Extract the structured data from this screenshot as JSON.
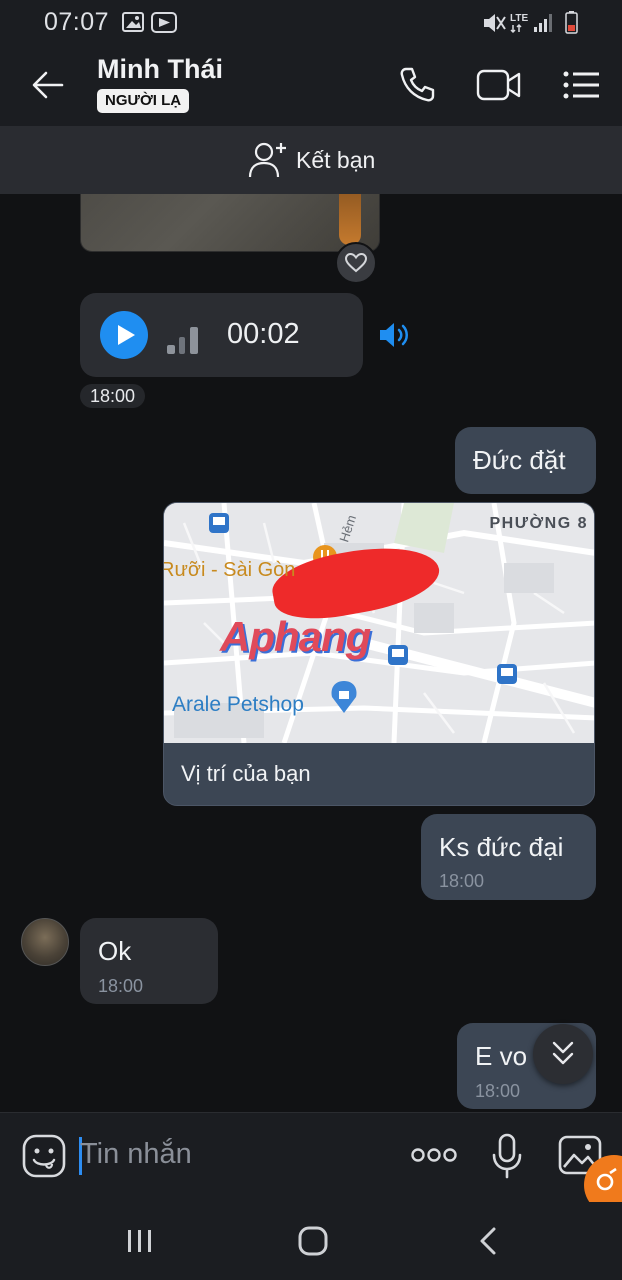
{
  "status_bar": {
    "time": "07:07",
    "network": "LTE"
  },
  "header": {
    "contact_name": "Minh Thái",
    "badge": "NGƯỜI LẠ",
    "icons": [
      "back-arrow-icon",
      "phone-icon",
      "video-call-icon",
      "menu-list-icon"
    ]
  },
  "add_friend": {
    "label": "Kết bạn",
    "icon": "add-user-icon"
  },
  "messages": {
    "voice": {
      "duration": "00:02",
      "time": "18:00"
    },
    "out1": {
      "text": "Đức đặt"
    },
    "location": {
      "caption": "Vị trí của bạn",
      "map_ward": "PHƯỜNG 8",
      "map_place": "Rưỡi - Sài Gòn",
      "map_shop": "Arale Petshop",
      "map_street": "Hẻm",
      "watermark": "Aphang"
    },
    "out2": {
      "text": "Ks đức đại",
      "time": "18:00"
    },
    "in1": {
      "text": "Ok",
      "time": "18:00"
    },
    "out3": {
      "text": "E vo",
      "time": "18:00"
    }
  },
  "input": {
    "placeholder": "Tin nhắn"
  },
  "colors": {
    "accent": "#1f8ef1",
    "bubble_out": "#3c4654",
    "bubble_in": "#2b2d32",
    "background": "#111214"
  }
}
